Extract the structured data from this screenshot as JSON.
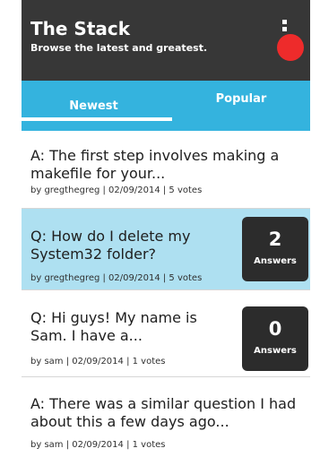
{
  "header": {
    "title": "The Stack",
    "subtitle": "Browse the latest and greatest.",
    "menu_icon": "overflow-menu-icon",
    "badge_color": "#ee2b2b"
  },
  "tabs": [
    {
      "label": "Newest",
      "selected": true
    },
    {
      "label": "Popular",
      "selected": false
    }
  ],
  "colors": {
    "header_bg": "#373737",
    "tab_bar_bg": "#34b3de",
    "highlight_bg": "#aee0f1",
    "answer_box_bg": "#2c2c2c"
  },
  "feed": [
    {
      "text": "A: The first step involves making a makefile for your...",
      "meta": "by gregthegreg | 02/09/2014 | 5 votes"
    },
    {
      "text": "Q: How do I delete my System32 folder?",
      "meta": "by gregthegreg | 02/09/2014 | 5 votes",
      "answers_count": "2",
      "answers_label": "Answers",
      "highlighted": true
    },
    {
      "text": "Q: Hi guys! My name is Sam. I have a...",
      "meta": "by sam | 02/09/2014 | 1 votes",
      "answers_count": "0",
      "answers_label": "Answers"
    },
    {
      "text": "A: There was a similar question I had about this a few days ago...",
      "meta": "by sam | 02/09/2014 | 1 votes"
    }
  ]
}
